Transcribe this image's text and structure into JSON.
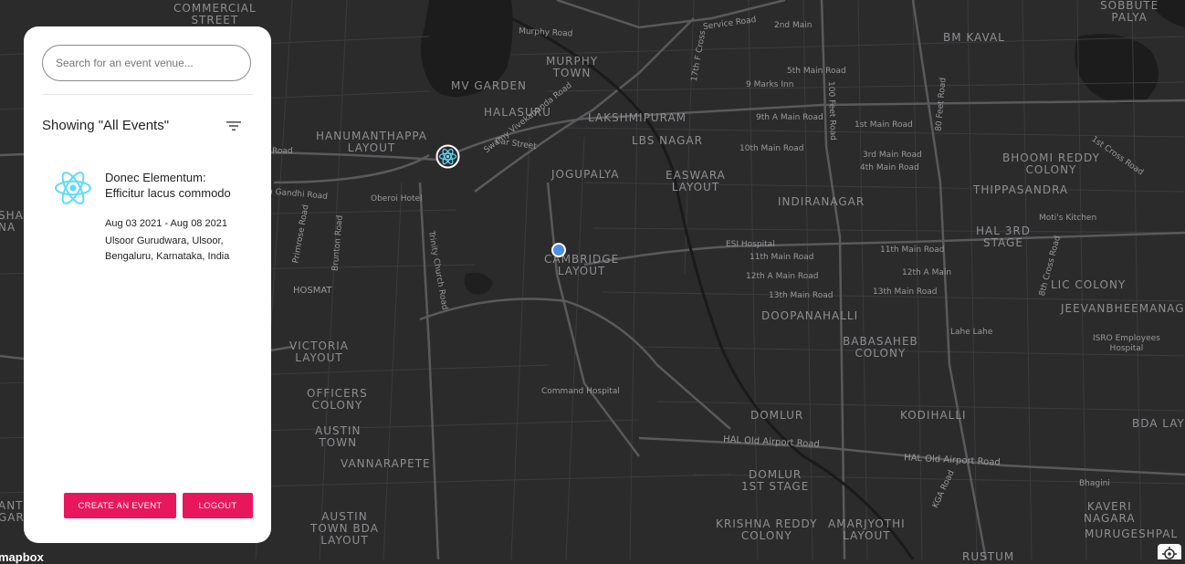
{
  "map": {
    "labels": {
      "commercial_street": "COMMERCIAL\nSTREET",
      "murphy_road": "Murphy Road",
      "murphy_town": "MURPHY\nTOWN",
      "service_road": "Service Road",
      "second_main": "2nd Main",
      "bm_kaval": "BM KAVAL",
      "sobbute_palya": "SOBBUTE\nPALYA",
      "mv_garden": "MV GARDEN",
      "seventeenth_f_cross": "17th F Cross",
      "fifth_main_road": "5th Main Road",
      "nine_marks_inn": "9 Marks Inn",
      "eighty_feet_road": "80 Feet Road",
      "hundred_feet_road": "100 Feet Road",
      "halasuru": "HALASURU",
      "lakshmipuram": "LAKSHMIPURAM",
      "ninth_a_main_road": "9th A Main Road",
      "first_main_road": "1st Main Road",
      "hanumanthappa_layout": "HANUMANTHAPPA\nLAYOUT",
      "lbs_nagar": "LBS NAGAR",
      "car_street": "Car Street",
      "swamy_vivekananda_road": "Swamy Vivekananda Road",
      "tenth_main_road": "10th Main Road",
      "third_main_road": "3rd Main Road",
      "fourth_main_road": "4th Main Road",
      "first_cross_road": "1st Cross Road",
      "bhoomi_reddy_colony": "BHOOMI REDDY\nCOLONY",
      "jogupalya": "JOGUPALYA",
      "easwara_layout": "EASWARA\nLAYOUT",
      "thippasandra": "THIPPASANDRA",
      "road_left": "Road",
      "gandhi_road": "a Gandhi Road",
      "oberoi_hotel": "Oberoi Hotel",
      "indiranagar": "INDIRANAGAR",
      "motis_kitchen": "Moti's Kitchen",
      "shan_na": "SHAN\nNA",
      "primrose_road": "Primrose Road",
      "brunton_road": "Brunton Road",
      "trinity_church_road": "Trinity Church Road",
      "hal_3rd_stage": "HAL 3RD\nSTAGE",
      "esi_hospital": "ESI Hospital",
      "eleventh_main_road_a": "11th Main Road",
      "eleventh_main_road_b": "11th Main Road",
      "cambridge_layout": "CAMBRIDGE\nLAYOUT",
      "twelfth_a_main_road": "12th A Main Road",
      "twelfth_a_main": "12th A Main",
      "eighth_cross_road": "8th Cross Road",
      "hosmat": "HOSMAT",
      "lic_colony": "LIC COLONY",
      "thirteenth_main_road_a": "13th Main Road",
      "thirteenth_main_road_b": "13th Main Road",
      "doopanahalli": "DOOPANAHALLI",
      "jeevanbheemanagar": "JEEVANBHEEMANAG",
      "lahe_lahe": "Lahe Lahe",
      "victoria_layout": "VICTORIA\nLAYOUT",
      "babasaheb_colony": "BABASAHEB\nCOLONY",
      "isro_employees_hospital": "ISRO Employees\nHospital",
      "command_hospital": "Command Hospital",
      "officers_colony": "OFFICERS\nCOLONY",
      "domlur": "DOMLUR",
      "kodihalli": "KODIHALLI",
      "bda_layout": "BDA LAYO",
      "austin_town": "AUSTIN\nTOWN",
      "hal_old_airport_road_a": "HAL Old Airport Road",
      "hal_old_airport_road_b": "HAL Old Airport Road",
      "vannarapete": "VANNARAPETE",
      "domlur_1st_stage": "DOMLUR\n1ST STAGE",
      "bhagini": "Bhagini",
      "kga_road": "KGA Road",
      "ant_gar": "ANT\nGAR",
      "austin_town_bda_layout": "AUSTIN\nTOWN BDA\nLAYOUT",
      "krishna_reddy_colony": "KRISHNA REDDY\nCOLONY",
      "amarjyothi_layout": "AMARJYOTHI\nLAYOUT",
      "kaveri_nagara": "KAVERI\nNAGARA",
      "murugeshpalya": "MURUGESHPAL",
      "rustum": "RUSTUM",
      "attribution": "mapbox"
    }
  },
  "panel": {
    "search_placeholder": "Search for an event venue...",
    "showing_label": "Showing \"All Events\"",
    "filter_icon": "filter-list-icon",
    "events": [
      {
        "title": "Donec Elementum: Efficitur lacus commodo",
        "date_range": "Aug 03 2021 - Aug 08 2021",
        "venue": "Ulsoor Gurudwara, Ulsoor, Bengaluru, Karnataka, India",
        "icon": "react-logo-icon"
      }
    ],
    "create_button": "CREATE AN EVENT",
    "logout_button": "LOGOUT"
  },
  "colors": {
    "accent": "#e8175d",
    "react_blue": "#61dafb",
    "map_background": "#2b2b2c",
    "user_location": "#4a90e2"
  }
}
